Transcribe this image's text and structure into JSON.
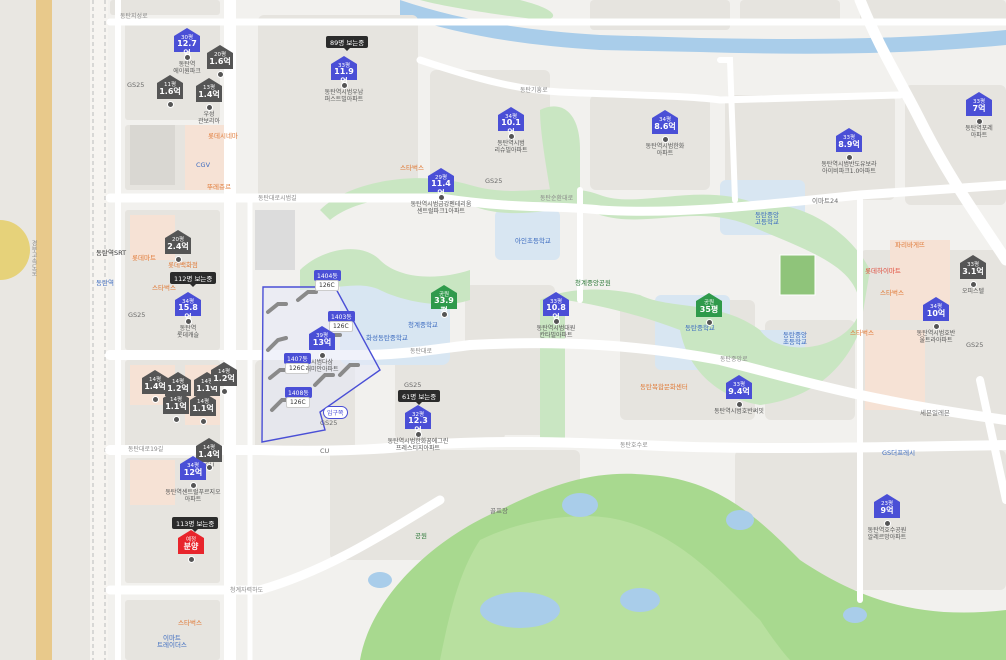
{
  "map": {
    "colors": {
      "water": "#a9cdea",
      "park": "#c9e6c2",
      "golf": "#a8d98f",
      "road": "#ffffff",
      "block": "#e8e6e2",
      "highlight": "#4a4fd6",
      "rail": "#d8c38a"
    },
    "roads": [
      "동탄지성로",
      "동탄대로시범길",
      "동탄대로19길",
      "동탄대로",
      "청계자력하도",
      "동탄순환대로",
      "동탄기흥로",
      "동탄대로시범길",
      "동탄대로",
      "동탄중앙로",
      "동탄호수로"
    ],
    "highway": "경부고속도로"
  },
  "price_markers": [
    {
      "py": "30평",
      "price": "12.7억",
      "name": "동탄역\n에이원파크",
      "color": "blue"
    },
    {
      "py": "20평",
      "price": "1.6억",
      "name": "",
      "color": "gray"
    },
    {
      "py": "11평",
      "price": "1.6억",
      "name": "",
      "color": "gray"
    },
    {
      "py": "13평",
      "price": "1.4억",
      "name": "우성\n관보리아",
      "color": "gray"
    },
    {
      "py": "33평",
      "price": "11.9억",
      "name": "동탄역시범우남\n퍼스트빌아파트",
      "color": "blue"
    },
    {
      "py": "34평",
      "price": "10.1억",
      "name": "동탄역시범\n리슈빌아파트",
      "color": "blue"
    },
    {
      "py": "34평",
      "price": "8.6억",
      "name": "동탄역시범한화\n아파트",
      "color": "blue"
    },
    {
      "py": "33평",
      "price": "8.9억",
      "name": "동탄역시범반도유보라\n아이비파크1.0아파트",
      "color": "blue"
    },
    {
      "py": "33평",
      "price": "7억",
      "name": "동탄역포레\n아파트",
      "color": "blue"
    },
    {
      "py": "29평",
      "price": "11.4억",
      "name": "동탄역시범금강펜테리움\n센트럴파크1아파트",
      "color": "blue"
    },
    {
      "py": "20평",
      "price": "2.4억",
      "name": "",
      "color": "gray"
    },
    {
      "py": "34평",
      "price": "15.8억",
      "name": "동탄역\n롯데캐슬",
      "color": "blue"
    },
    {
      "py": "39평",
      "price": "13억",
      "name": "시범다삼\n래미안아파트",
      "color": "blue"
    },
    {
      "py": "공원",
      "price": "33.9평",
      "name": "",
      "color": "green"
    },
    {
      "py": "33평",
      "price": "10.8억",
      "name": "동탄역시범대원\n칸타빌아파트",
      "color": "blue"
    },
    {
      "py": "공원",
      "price": "35평",
      "name": "",
      "color": "green"
    },
    {
      "py": "33평",
      "price": "3.1억",
      "name": "오피스텔",
      "color": "gray"
    },
    {
      "py": "34평",
      "price": "10억",
      "name": "동탄역시범호반\n울트라아파트",
      "color": "blue"
    },
    {
      "py": "33평",
      "price": "9.4억",
      "name": "동탄역시범호반써밋",
      "color": "blue"
    },
    {
      "py": "32평",
      "price": "12.3억",
      "name": "동탄역시범한화꿈에그린\n프레스티지아파트",
      "color": "blue"
    },
    {
      "py": "14평",
      "price": "1.4억",
      "name": "",
      "color": "gray"
    },
    {
      "py": "14평",
      "price": "1.2억",
      "name": "",
      "color": "gray"
    },
    {
      "py": "14평",
      "price": "1.1억",
      "name": "",
      "color": "gray"
    },
    {
      "py": "14평",
      "price": "1.1억",
      "name": "",
      "color": "gray"
    },
    {
      "py": "14평",
      "price": "1.2억",
      "name": "",
      "color": "gray"
    },
    {
      "py": "14평",
      "price": "1.1억",
      "name": "",
      "color": "gray"
    },
    {
      "py": "14평",
      "price": "1.4억",
      "name": "",
      "color": "gray"
    },
    {
      "py": "34평",
      "price": "12억",
      "name": "동탄역센트럴푸르지오\n아파트",
      "color": "blue"
    },
    {
      "py": "예정",
      "price": "분양",
      "name": "",
      "color": "red"
    },
    {
      "py": "23평",
      "price": "9억",
      "name": "동탄역호수공원\n알레르망아파트",
      "color": "blue"
    }
  ],
  "badges": [
    "89명 보는중",
    "112명 보는중",
    "61명 보는중",
    "113명 보는중"
  ],
  "dong_labels": [
    {
      "dong": "1404동",
      "type": "126C"
    },
    {
      "dong": "1403동",
      "type": "126C"
    },
    {
      "dong": "1407동",
      "type": "126C"
    },
    {
      "dong": "1408동",
      "type": "126C"
    }
  ],
  "entrance": "입구쪽",
  "pois": {
    "gs25_a": "GS25",
    "gs25_b": "GS25",
    "gs25_c": "GS25",
    "gs25_d": "GS25",
    "gs25_e": "GS25",
    "gs25_f": "GS25",
    "cgv": "CGV",
    "lotte_dept": "롯데백화점",
    "lotte_mart": "롯데마트",
    "lotte_cinema": "롯데시네마",
    "tous": "뚜레쥬르",
    "starbucks_a": "스타벅스",
    "starbucks_b": "스타벅스",
    "starbucks_c": "스타벅스",
    "starbucks_d": "스타벅스",
    "emart": "이마트\n트레이더스",
    "cu_a": "CU",
    "cu_b": "CU",
    "dongtan_srt": "동탄역SRT",
    "dongtan": "동탄역",
    "school_a": "화성동탄중학교",
    "school_b": "청계중학교",
    "school_c": "아인초등학교",
    "school_d": "동탄중앙\n고등학교",
    "school_e": "동탄중앙\n초등학교",
    "school_f": "동탄중학교",
    "park_a": "청계중앙공원",
    "bus": "이마트24",
    "paris": "파리바게뜨",
    "library": "동탄복합문화센터",
    "hospital": "세븐일레븐",
    "golf": "골프장",
    "gongwon": "공원",
    "lotte_hi": "롯데하이마트",
    "gs_the_fresh": "GS더프레시",
    "starbucks_drive": "스타벅스"
  }
}
